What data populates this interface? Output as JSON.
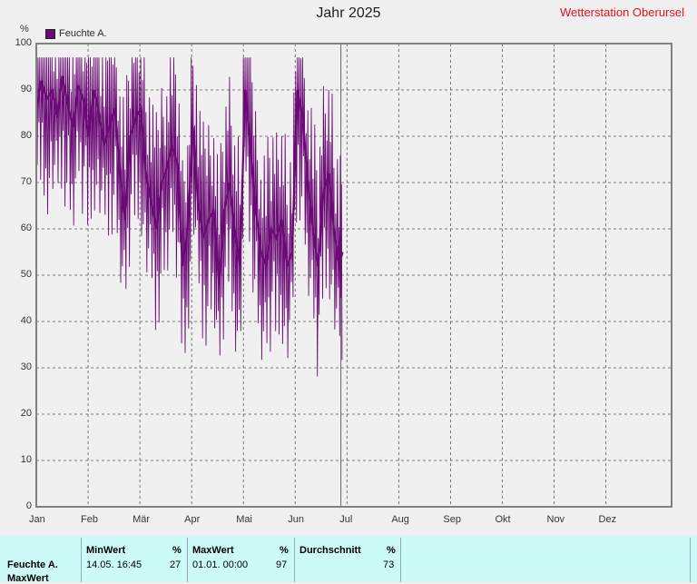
{
  "header": {
    "station": "Wetterstation Oberursel",
    "unit": "%"
  },
  "chart_data": {
    "type": "line",
    "title": "Jahr 2025",
    "xlabel": "",
    "ylabel": "%",
    "x_labels": [
      "Jan",
      "Feb",
      "Mär",
      "Apr",
      "Mai",
      "Jun",
      "Jul",
      "Aug",
      "Sep",
      "Okt",
      "Nov",
      "Dez"
    ],
    "ylim": [
      0,
      100
    ],
    "yticks": [
      0,
      10,
      20,
      30,
      40,
      50,
      60,
      70,
      80,
      90,
      100
    ],
    "xlim_days": [
      0,
      365
    ],
    "grid": true,
    "legend": "top-left",
    "cursor_day": 175,
    "series": [
      {
        "name": "Feuchte A.",
        "color": "#6a0a74",
        "days": [
          0,
          3,
          6,
          9,
          12,
          15,
          18,
          21,
          24,
          27,
          30,
          33,
          36,
          39,
          42,
          45,
          48,
          51,
          54,
          57,
          60,
          63,
          66,
          69,
          72,
          75,
          78,
          81,
          84,
          87,
          90,
          93,
          96,
          99,
          102,
          105,
          108,
          111,
          114,
          117,
          120,
          123,
          126,
          129,
          132,
          135,
          138,
          141,
          144,
          147,
          150,
          153,
          156,
          159,
          162,
          165,
          168,
          171,
          174,
          176
        ],
        "values": [
          86,
          92,
          88,
          90,
          84,
          93,
          87,
          82,
          91,
          88,
          80,
          90,
          85,
          78,
          82,
          86,
          73,
          62,
          80,
          84,
          86,
          72,
          66,
          60,
          70,
          73,
          78,
          74,
          52,
          60,
          82,
          65,
          58,
          62,
          64,
          48,
          64,
          70,
          60,
          52,
          90,
          78,
          65,
          55,
          52,
          60,
          58,
          62,
          52,
          55,
          90,
          84,
          70,
          60,
          52,
          68,
          72,
          60,
          52,
          55
        ]
      }
    ],
    "summary": {
      "row_label": "Feuchte A.",
      "row_label_2": "MaxWert",
      "columns": [
        {
          "header": "MinWert",
          "unit": "%",
          "date": "14.05.  16:45",
          "value": "27"
        },
        {
          "header": "MaxWert",
          "unit": "%",
          "date": "01.01.  00:00",
          "value": "97"
        },
        {
          "header": "Durchschnitt",
          "unit": "%",
          "date": "",
          "value": "73"
        }
      ]
    }
  }
}
